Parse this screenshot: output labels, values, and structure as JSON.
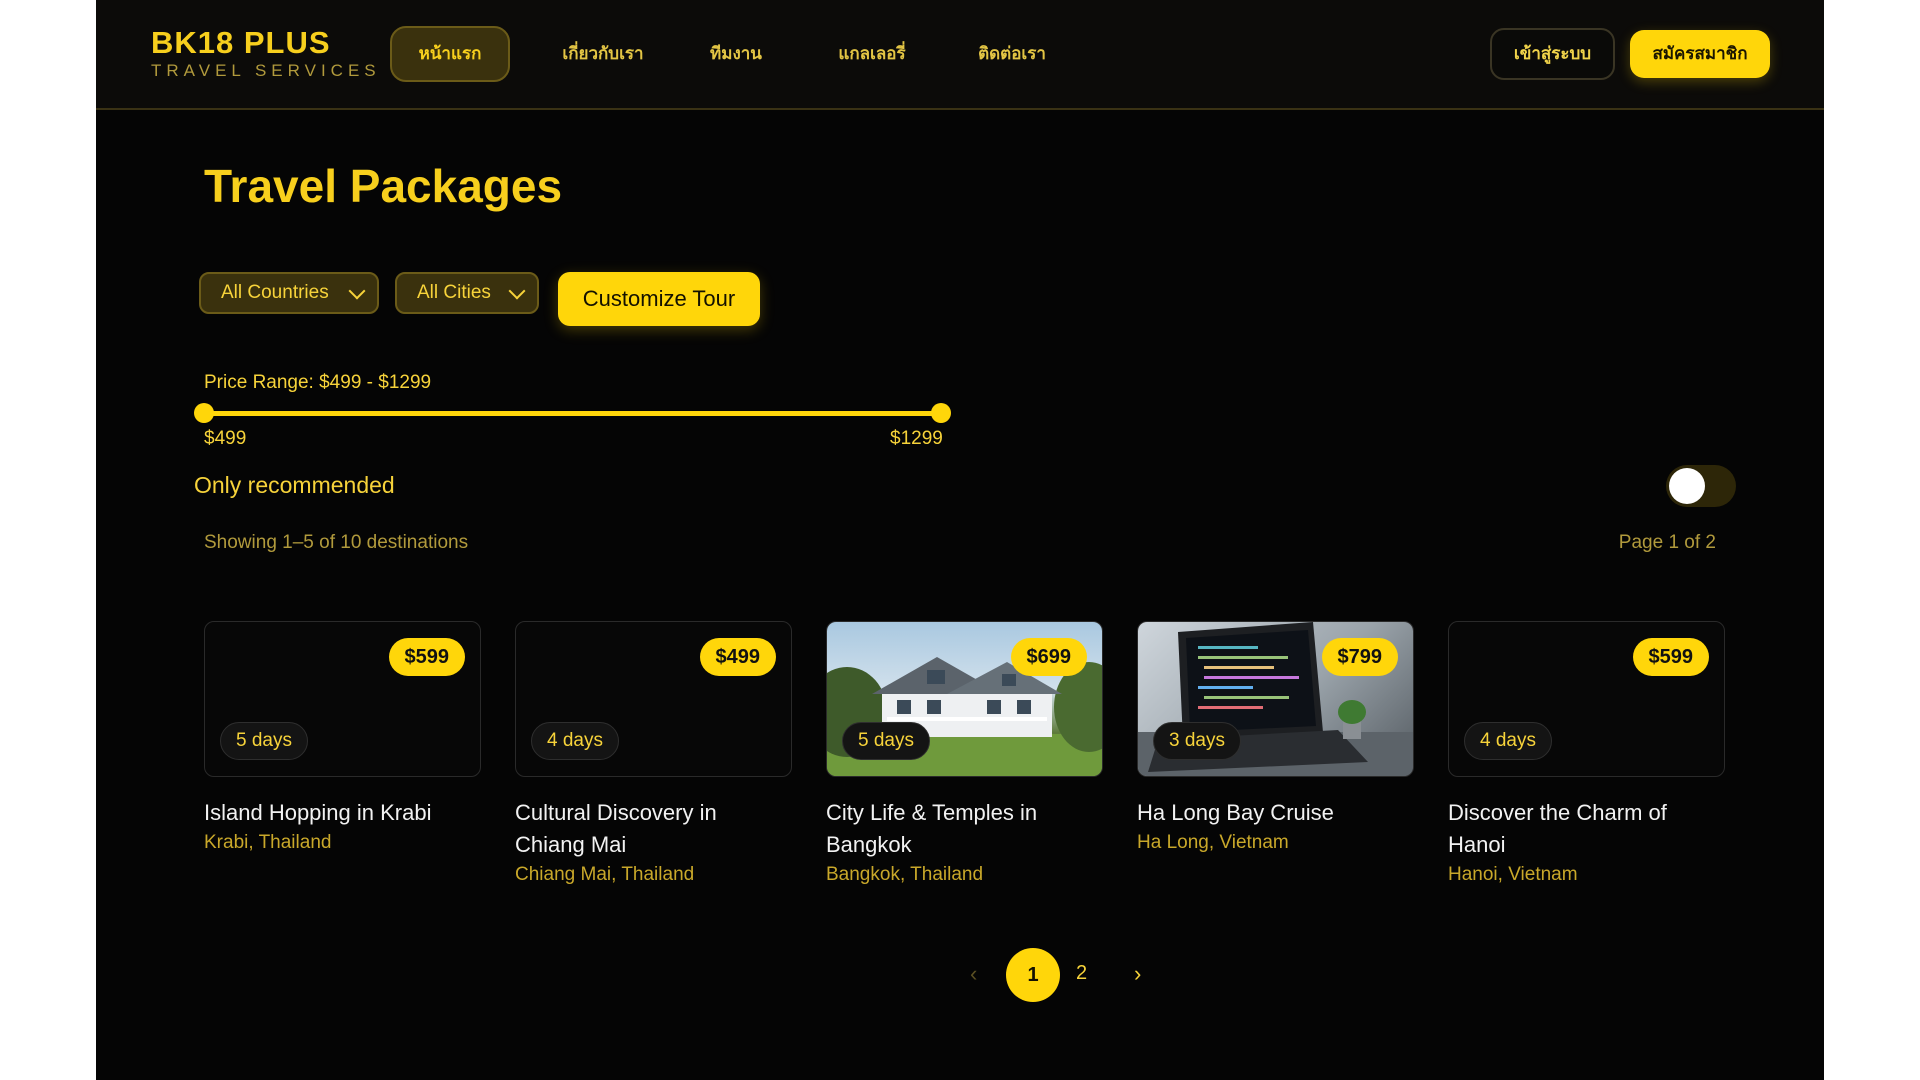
{
  "brand": {
    "name": "BK18 PLUS",
    "tagline": "TRAVEL SERVICES"
  },
  "nav": {
    "items": [
      {
        "label": "หน้าแรก",
        "active": true
      },
      {
        "label": "เกี่ยวกับเรา",
        "active": false
      },
      {
        "label": "ทีมงาน",
        "active": false
      },
      {
        "label": "แกลเลอรี่",
        "active": false
      },
      {
        "label": "ติดต่อเรา",
        "active": false
      }
    ],
    "login": "เข้าสู่ระบบ",
    "signup": "สมัครสมาชิก"
  },
  "page": {
    "title": "Travel Packages"
  },
  "filters": {
    "country": "All Countries",
    "city": "All Cities",
    "customize": "Customize Tour"
  },
  "price": {
    "label": "Price Range: $499 - $1299",
    "min_label": "$499",
    "max_label": "$1299",
    "range_min": 499,
    "range_max": 1299,
    "selected_min": 499,
    "selected_max": 1299
  },
  "recommended": {
    "label": "Only recommended",
    "on": false
  },
  "results": {
    "showing": "Showing 1–5 of 10 destinations",
    "page": "Page 1 of 2"
  },
  "cards": [
    {
      "price": "$599",
      "days": "5 days",
      "title": "Island Hopping in Krabi",
      "location": "Krabi, Thailand",
      "image": "none"
    },
    {
      "price": "$499",
      "days": "4 days",
      "title": "Cultural Discovery in Chiang Mai",
      "location": "Chiang Mai, Thailand",
      "image": "none"
    },
    {
      "price": "$699",
      "days": "5 days",
      "title": "City Life & Temples in Bangkok",
      "location": "Bangkok, Thailand",
      "image": "house-photo"
    },
    {
      "price": "$799",
      "days": "3 days",
      "title": "Ha Long Bay Cruise",
      "location": "Ha Long, Vietnam",
      "image": "laptop-photo"
    },
    {
      "price": "$599",
      "days": "4 days",
      "title": "Discover the Charm of Hanoi",
      "location": "Hanoi, Vietnam",
      "image": "none"
    }
  ],
  "pagination": {
    "prev": "‹",
    "pages": [
      "1",
      "2"
    ],
    "current": "1",
    "next": "›"
  },
  "colors": {
    "accent": "#ffd60a",
    "background": "#050505",
    "text_accent": "#f7cf1d"
  }
}
